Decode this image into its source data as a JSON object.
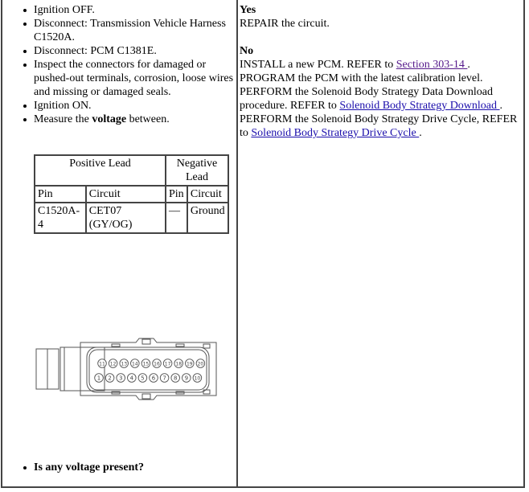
{
  "left_column": {
    "steps": [
      {
        "text": "Ignition OFF."
      },
      {
        "text": "Disconnect: Transmission Vehicle Harness C1520A."
      },
      {
        "text": "Disconnect: PCM C1381E."
      },
      {
        "text": "Inspect the connectors for damaged or pushed-out terminals, corrosion, loose wires and missing or damaged seals."
      },
      {
        "text": "Ignition ON."
      },
      {
        "pre": "Measure the ",
        "bold": "voltage",
        "post": " between."
      }
    ],
    "table": {
      "positive_header": "Positive Lead",
      "negative_header": "Negative Lead",
      "columns": [
        "Pin",
        "Circuit",
        "Pin",
        "Circuit"
      ],
      "rows": [
        [
          "C1520A-4",
          "CET07 (GY/OG)",
          "—",
          "Ground"
        ]
      ]
    },
    "connector": {
      "top_row_pins": [
        "11",
        "12",
        "13",
        "14",
        "15",
        "16",
        "17",
        "18",
        "19",
        "20"
      ],
      "bottom_row_pins": [
        "1",
        "2",
        "3",
        "4",
        "5",
        "6",
        "7",
        "8",
        "9",
        "10"
      ]
    },
    "question": "Is any voltage present?"
  },
  "right_column": {
    "yes_label": "Yes",
    "yes_text": "REPAIR the circuit.",
    "no_label": "No",
    "no_line1_pre": "INSTALL a new PCM. REFER to ",
    "no_line1_link": "Section 303-14 ",
    "no_line1_post": ".",
    "no_line2": "PROGRAM the PCM with the latest calibration level.",
    "no_line3_pre": "PERFORM the Solenoid Body Strategy Data Download procedure. REFER to ",
    "no_line3_link": "Solenoid Body Strategy Download ",
    "no_line3_post": ".",
    "no_line4_pre": "PERFORM the Solenoid Body Strategy Drive Cycle, REFER to ",
    "no_line4_link": "Solenoid Body Strategy Drive Cycle ",
    "no_line4_post": "."
  }
}
